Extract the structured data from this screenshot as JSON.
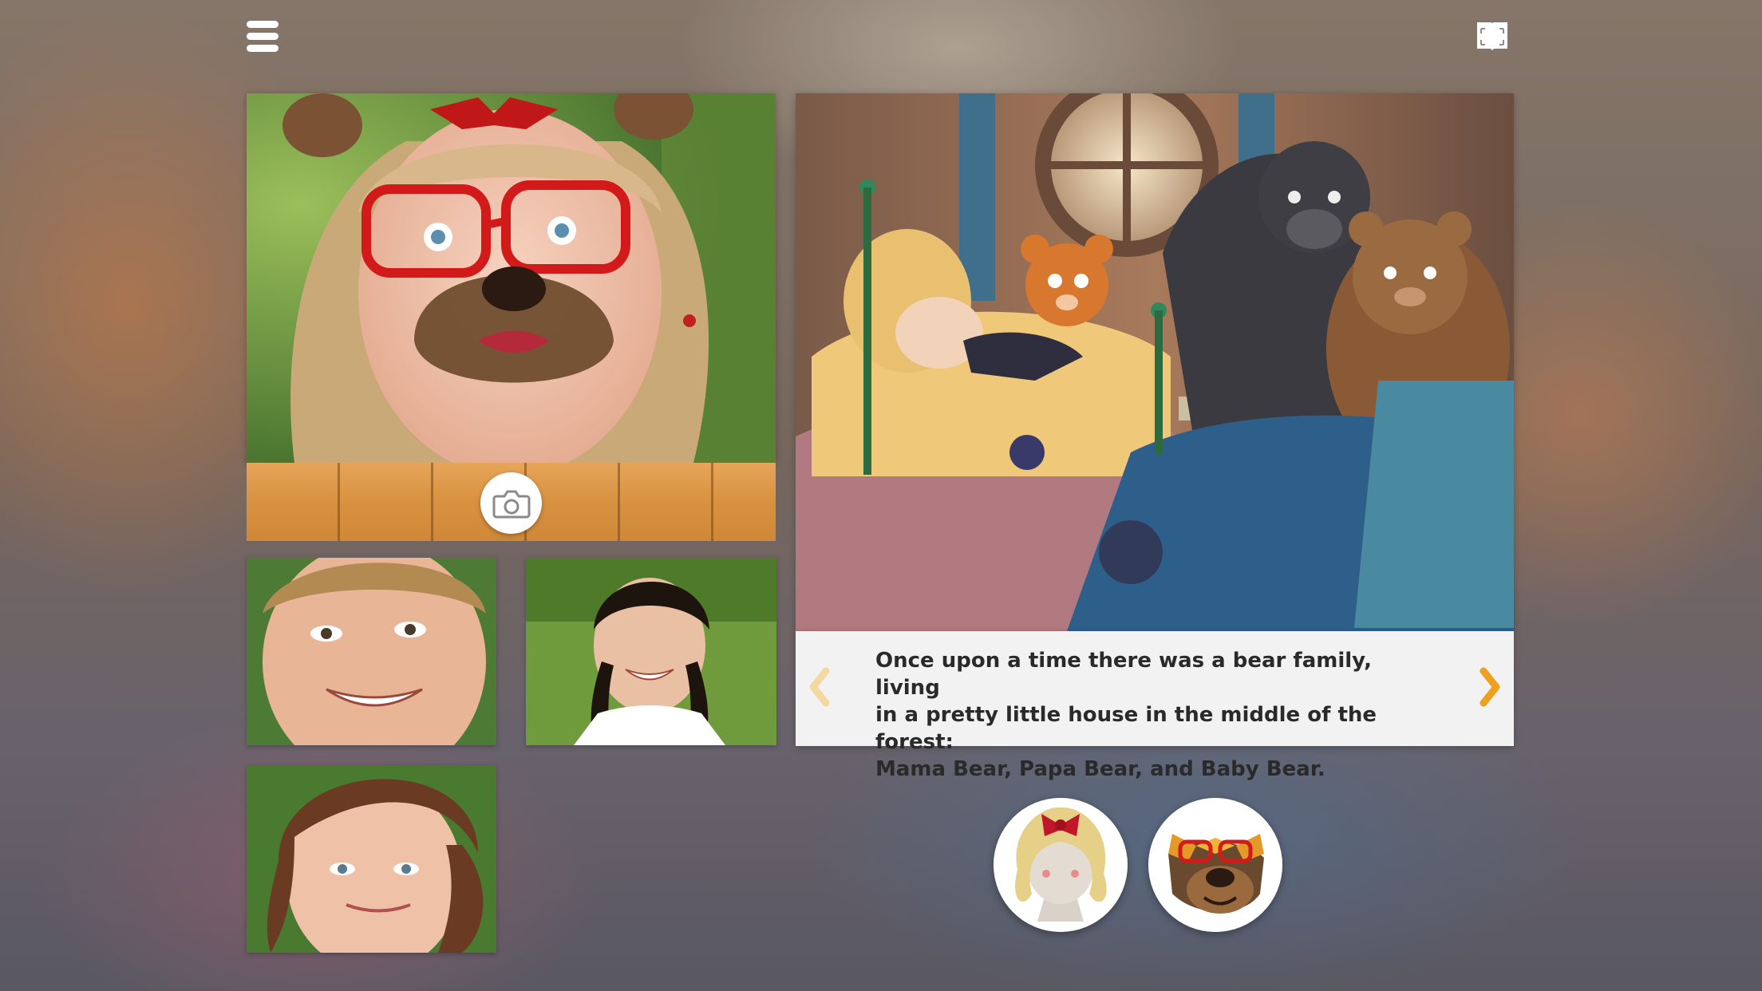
{
  "toolbar": {
    "menu_icon": "hamburger-menu-icon",
    "book_icon": "open-book-icon"
  },
  "camera": {
    "icon": "camera-icon"
  },
  "story": {
    "lines": [
      "Once upon a time there was a bear family, living",
      "in a pretty little house in the middle of the forest:",
      "Mama Bear, Papa Bear, and Baby Bear."
    ],
    "prev_icon": "chevron-left-icon",
    "next_icon": "chevron-right-icon"
  },
  "masks": [
    {
      "name": "goldilocks-mask-icon"
    },
    {
      "name": "bear-mask-icon"
    }
  ],
  "colors": {
    "accent_orange": "#f0a020",
    "arrow_inactive": "#f5d7a0",
    "text_box": "#f2f2f2"
  }
}
